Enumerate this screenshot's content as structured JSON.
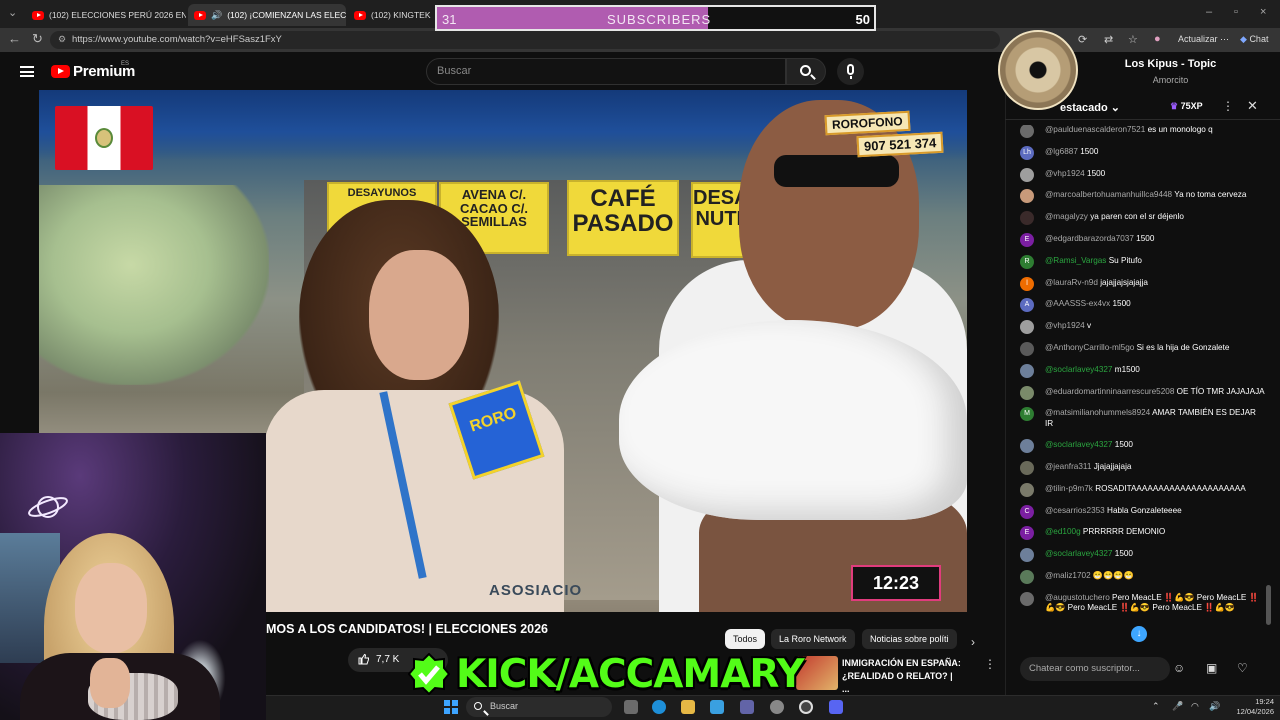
{
  "browser": {
    "tabs": [
      {
        "label": "(102) ELECCIONES PERÚ 2026 EN",
        "active": false
      },
      {
        "label": "(102) ¡COMIENZAN LAS ELECC",
        "active": true
      },
      {
        "label": "(102) KINGTEK",
        "active": false
      }
    ],
    "url": "https://www.youtube.com/watch?v=eHFSasz1FxY",
    "update_label": "Actualizar",
    "chat_label": "Chat"
  },
  "subscriber_goal": {
    "current": "31",
    "label": "SUBSCRIBERS",
    "target": "50",
    "progress_fraction": 0.62,
    "fill_color": "#b05cb0"
  },
  "youtube": {
    "logo_text": "Premium",
    "region": "ES",
    "search_placeholder": "Buscar",
    "brand_color": "#ff0000"
  },
  "video": {
    "overlay": {
      "station": "ROROFONO",
      "phone": "907 521 374",
      "timer": "12:23",
      "signs": [
        "DESAYUNOS",
        "AVENA C/. CACAO C/. SEMILLAS",
        "CAFÉ PASADO",
        "DESAY NUTRI"
      ],
      "mic_brand": "RORO",
      "bottom_sign": "ASOSIACIO"
    },
    "title": "MOS A LOS CANDIDATOS! | ELECCIONES 2026",
    "likes": "7,7 K"
  },
  "filter_chips": [
    {
      "label": "Todos",
      "active": true
    },
    {
      "label": "La Roro Network",
      "active": false
    },
    {
      "label": "Noticias sobre políti",
      "active": false
    }
  ],
  "recommendation": {
    "title": "INMIGRACIÓN EN ESPAÑA: ¿REALIDAD O RELATO? | ..."
  },
  "kick_banner": {
    "text": "KICK/ACCAMARY",
    "color": "#53fc18"
  },
  "now_playing": {
    "title": "Los Kipus - Topic",
    "track": "Amorcito"
  },
  "chat": {
    "mode_label": "estacado",
    "xp": "75XP",
    "input_placeholder": "Chatear como suscriptor...",
    "messages": [
      {
        "author": "@paulduenascalderon7521",
        "text": "es un monologo q",
        "avatar": "img",
        "color": "#6b6b6b",
        "green": false
      },
      {
        "author": "@lg6887",
        "text": "1500",
        "avatar": "Lh",
        "color": "#5c6bc0",
        "green": false
      },
      {
        "author": "@vhp1924",
        "text": "1500",
        "avatar": "img",
        "color": "#9e9e9e",
        "green": false
      },
      {
        "author": "@marcoalbertohuamanhuillca9448",
        "text": "Ya no toma cerveza",
        "avatar": "img",
        "color": "#c89a7a",
        "green": false
      },
      {
        "author": "@magalyzy",
        "text": "ya paren con el sr déjenlo",
        "avatar": "img",
        "color": "#3a2a2a",
        "green": false
      },
      {
        "author": "@edgardbarazorda7037",
        "text": "1500",
        "avatar": "E",
        "color": "#7b1fa2",
        "green": false
      },
      {
        "author": "@Ramsi_Vargas",
        "text": "Su Pitufo",
        "avatar": "R",
        "color": "#2e7d32",
        "green": true
      },
      {
        "author": "@lauraRv-n9d",
        "text": "jajajjajsjajajja",
        "avatar": "l",
        "color": "#ef6c00",
        "green": false
      },
      {
        "author": "@AAASSS-ex4vx",
        "text": "1500",
        "avatar": "A",
        "color": "#5c6bc0",
        "green": false
      },
      {
        "author": "@vhp1924",
        "text": "v",
        "avatar": "img",
        "color": "#9e9e9e",
        "green": false
      },
      {
        "author": "@AnthonyCarrillo-ml5go",
        "text": "Si es la hija de Gonzalete",
        "avatar": "img",
        "color": "#5a5a5a",
        "green": false
      },
      {
        "author": "@soclarlavey4327",
        "text": "m1500",
        "avatar": "img",
        "color": "#6d7f9a",
        "green": true
      },
      {
        "author": "@eduardomartinninaarrescure5208",
        "text": "OE TÍO TMR JAJAJAJA",
        "avatar": "img",
        "color": "#7a8a6a",
        "green": false
      },
      {
        "author": "@matsimilianohummels8924",
        "text": "AMAR TAMBIÉN ES DEJAR IR",
        "avatar": "M",
        "color": "#2e7d32",
        "green": false
      },
      {
        "author": "@soclarlavey4327",
        "text": "1500",
        "avatar": "img",
        "color": "#6d7f9a",
        "green": true
      },
      {
        "author": "@jeanfra311",
        "text": "Jjajajjajaja",
        "avatar": "img",
        "color": "#6a6a5a",
        "green": false
      },
      {
        "author": "@tilin-p9m7k",
        "text": "ROSADITAAAAAAAAAAAAAAAAAAAAA",
        "avatar": "img",
        "color": "#7a7a6a",
        "green": false
      },
      {
        "author": "@cesarrios2353",
        "text": "Habla Gonzaleteeee",
        "avatar": "C",
        "color": "#7b1fa2",
        "green": false
      },
      {
        "author": "@ed100g",
        "text": "PRRRRRR DEMONIO",
        "avatar": "E",
        "color": "#7b1fa2",
        "green": true
      },
      {
        "author": "@soclarlavey4327",
        "text": "1500",
        "avatar": "img",
        "color": "#6d7f9a",
        "green": true
      },
      {
        "author": "@maliz1702",
        "text": "😁😁😁😁",
        "avatar": "img",
        "color": "#5a7a5a",
        "green": false
      },
      {
        "author": "@augustotuchero",
        "text": "Pero MeacLE ‼️💪😎 Pero MeacLE ‼️💪😎 Pero MeacLE ‼️💪😎 Pero MeacLE ‼️💪😎",
        "avatar": "img",
        "color": "#6a6a6a",
        "green": false
      }
    ]
  },
  "taskbar": {
    "search_placeholder": "Buscar",
    "time": "19:24",
    "date": "12/04/2026"
  }
}
